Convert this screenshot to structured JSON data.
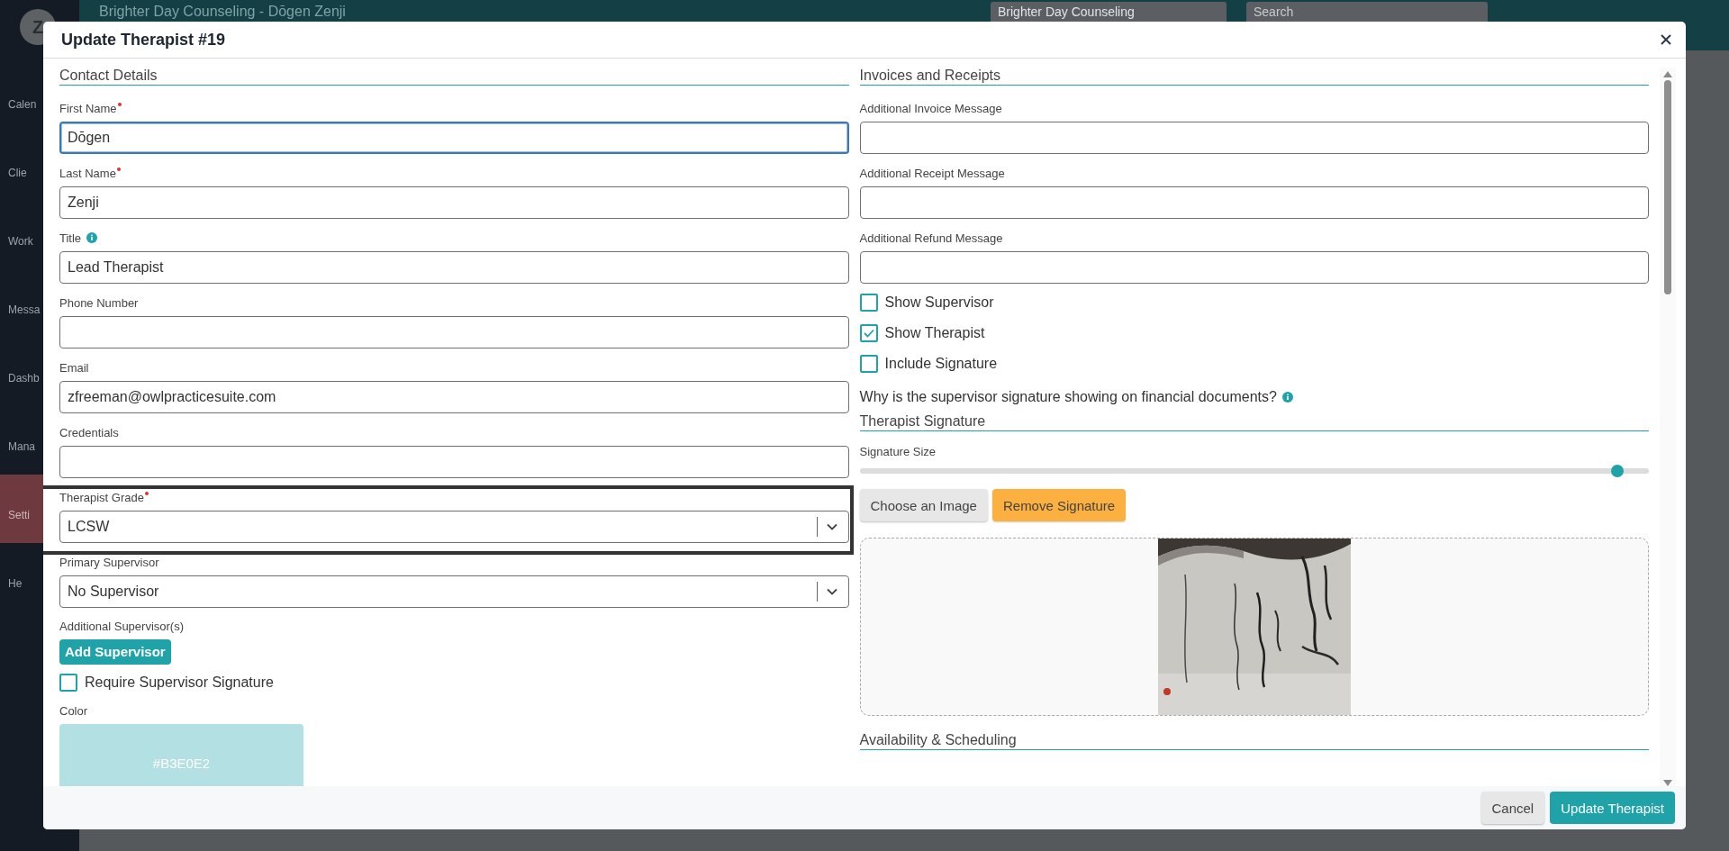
{
  "app": {
    "header_title": "Brighter Day Counseling - Dōgen Zenji",
    "practice_select": {
      "value": "Brighter Day Counseling"
    },
    "search": {
      "placeholder": "Search"
    },
    "avatar": "Z",
    "sidebar": [
      {
        "label": "Calen",
        "selected": false
      },
      {
        "label": "Clie",
        "selected": false
      },
      {
        "label": "Work",
        "selected": false
      },
      {
        "label": "Messa",
        "selected": false
      },
      {
        "label": "Dashb",
        "selected": false
      },
      {
        "label": "Mana",
        "selected": false
      },
      {
        "label": "Setti",
        "selected": true
      },
      {
        "label": "He",
        "selected": false
      }
    ]
  },
  "modal": {
    "title": "Update Therapist #19",
    "left": {
      "section": "Contact Details",
      "fields": [
        {
          "kind": "text",
          "label": "First Name",
          "required": true,
          "value": "Dōgen",
          "focused": true
        },
        {
          "kind": "text",
          "label": "Last Name",
          "required": true,
          "value": "Zenji"
        },
        {
          "kind": "text",
          "label": "Title",
          "info": true,
          "value": "Lead Therapist"
        },
        {
          "kind": "text",
          "label": "Phone Number"
        },
        {
          "kind": "text",
          "label": "Email",
          "value": "zfreeman@owlpracticesuite.com"
        },
        {
          "kind": "text",
          "label": "Credentials"
        },
        {
          "kind": "select",
          "label": "Therapist Grade",
          "required": true,
          "value": "LCSW",
          "highlighted": true
        },
        {
          "kind": "select",
          "label": "Primary Supervisor",
          "value": "No Supervisor"
        }
      ],
      "additional_supervisors": {
        "label": "Additional Supervisor(s)",
        "button": "Add Supervisor"
      },
      "require_signature": {
        "label": "Require Supervisor Signature",
        "checked": false
      },
      "color": {
        "label": "Color",
        "value": "#B3E0E2",
        "color": "#b3e0e2"
      }
    },
    "right": {
      "section": "Invoices and Receipts",
      "fields": [
        {
          "kind": "text",
          "label": "Additional Invoice Message"
        },
        {
          "kind": "text",
          "label": "Additional Receipt Message"
        },
        {
          "kind": "text",
          "label": "Additional Refund Message"
        }
      ],
      "checkboxes": [
        {
          "label": "Show Supervisor",
          "checked": false
        },
        {
          "label": "Show Therapist",
          "checked": true
        },
        {
          "label": "Include Signature",
          "checked": false
        }
      ],
      "note": "Why is the supervisor signature showing on financial documents?",
      "signature_section": "Therapist Signature",
      "signature_size": {
        "label": "Signature Size",
        "level": 0.96
      },
      "buttons": [
        {
          "label": "Choose an Image",
          "kind": "secondary"
        },
        {
          "label": "Remove Signature",
          "kind": "warning"
        }
      ],
      "next_section": "Availability & Scheduling"
    },
    "footer": [
      {
        "label": "Cancel",
        "kind": "secondary"
      },
      {
        "label": "Update Therapist",
        "kind": "primary"
      }
    ]
  }
}
